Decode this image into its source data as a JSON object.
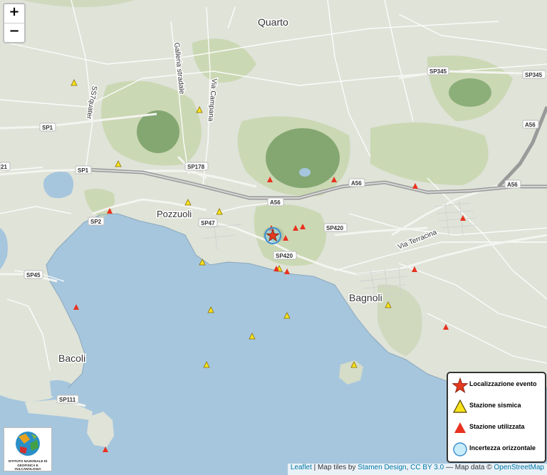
{
  "map": {
    "zoom_in_label": "+",
    "zoom_out_label": "−",
    "places": {
      "quarto": "Quarto",
      "pozzuoli": "Pozzuoli",
      "bagnoli": "Bagnoli",
      "bacoli": "Bacoli"
    },
    "road_labels": {
      "galleria": "Galleria stradale",
      "via_campana": "Via Campana",
      "ss7quater": "SS7quater",
      "via_terracina": "Via Terracina",
      "sp345_a": "SP345",
      "sp345_b": "SP345",
      "a56_1": "A56",
      "a56_2": "A56",
      "a56_3": "A56",
      "a56_4": "A56",
      "sp1_a": "SP1",
      "sp1_b": "SP1",
      "sp178": "SP178",
      "sp2": "SP2",
      "sp47": "SP47",
      "sp420_a": "SP420",
      "sp420_b": "SP420",
      "sp45": "SP45",
      "sp111": "SP111",
      "cut_edge": "21"
    },
    "legend": {
      "event": "Localizzazione evento",
      "station": "Stazione sismica",
      "used_station": "Stazione utilizzata",
      "uncertainty": "Incertezza orizzontale"
    },
    "attribution": {
      "leaflet": "Leaflet",
      "sep1": " | Map tiles by ",
      "stamen": "Stamen Design",
      "comma": ", ",
      "ccby": "CC BY 3.0",
      "sep2": " — Map data © ",
      "osm": "OpenStreetMap"
    },
    "logo_text": "ISTITUTO NAZIONALE DI GEOFISICA E VULCANOLOGIA",
    "colors": {
      "sea": "#a6c6dd",
      "land": "#dfe3d8",
      "hill": "#c9d6b0",
      "crater": "#7ea26a",
      "event_star": "#e53a1f",
      "station_yellow": "#f7e31c",
      "station_red": "#e8321f",
      "uncertainty_circle": "#8fd3f6"
    },
    "icons": [
      "event-star-icon",
      "yellow-triangle-icon",
      "red-triangle-icon",
      "uncertainty-circle-icon"
    ]
  }
}
